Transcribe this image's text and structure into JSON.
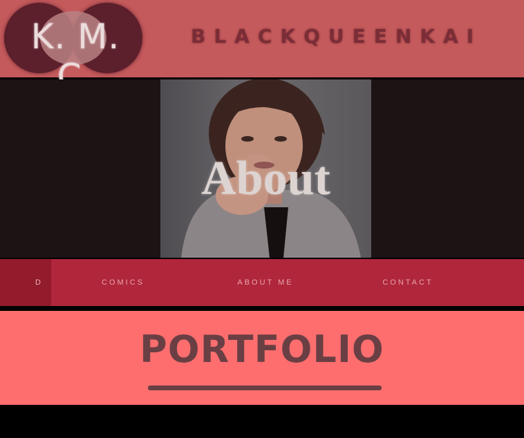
{
  "header": {
    "logo_text": "K. M. C.",
    "site_name": "BLACKQUEENKAI"
  },
  "hero": {
    "title": "About"
  },
  "nav": {
    "items": [
      {
        "label": "D",
        "active": true
      },
      {
        "label": "COMICS",
        "active": false
      },
      {
        "label": "ABOUT ME",
        "active": false
      },
      {
        "label": "CONTACT",
        "active": false
      }
    ]
  },
  "section": {
    "title": "PORTFOLIO"
  },
  "colors": {
    "header_bg": "#c45a5c",
    "hero_bg": "#1c1315",
    "nav_bg": "#b0263a",
    "nav_active_bg": "#921b2c",
    "section_bg": "#ff6e6e",
    "heading_text": "#6a3f44"
  }
}
